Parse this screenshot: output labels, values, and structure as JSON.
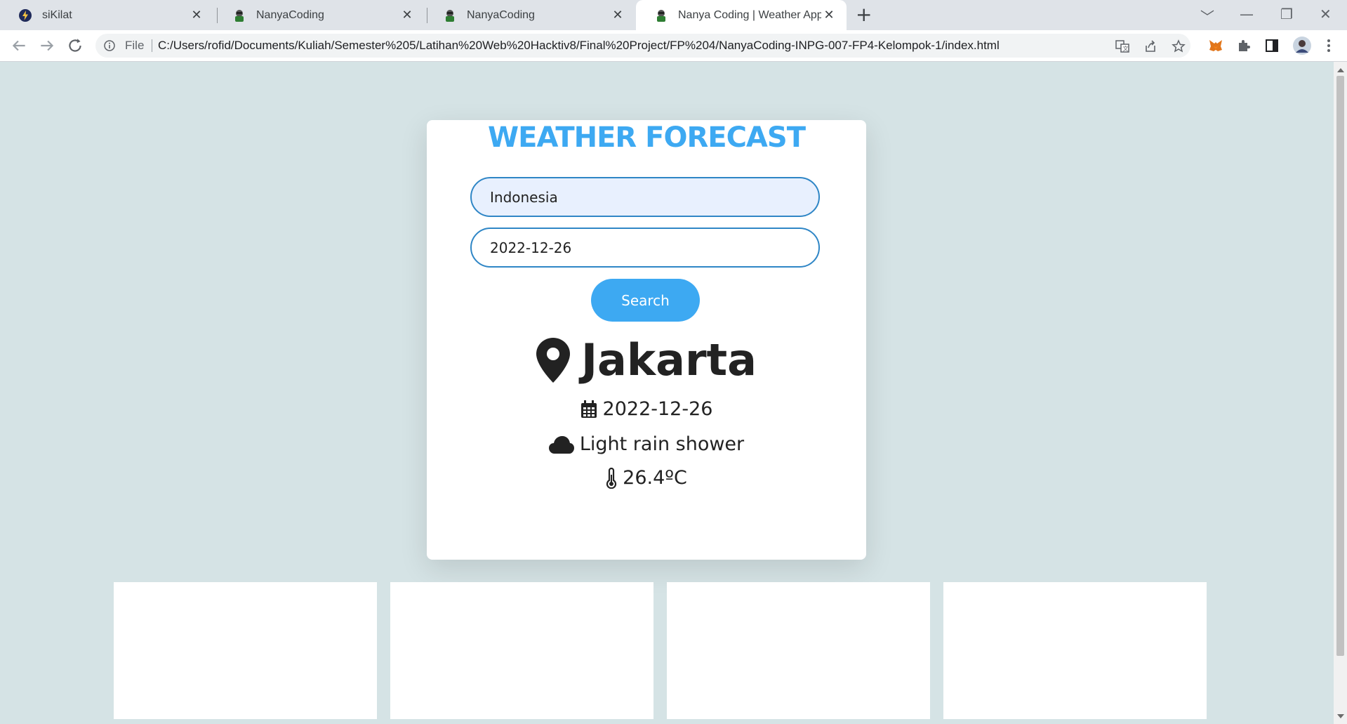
{
  "browser": {
    "tabs": [
      {
        "title": "siKilat"
      },
      {
        "title": "NanyaCoding"
      },
      {
        "title": "NanyaCoding"
      },
      {
        "title": "Nanya Coding | Weather App"
      }
    ],
    "omnibox": {
      "scheme_label": "File",
      "url": "C:/Users/rofid/Documents/Kuliah/Semester%205/Latihan%20Web%20Hacktiv8/Final%20Project/FP%204/NanyaCoding-INPG-007-FP4-Kelompok-1/index.html"
    }
  },
  "page": {
    "title": "WEATHER FORECAST",
    "country_input": {
      "value": "Indonesia"
    },
    "date_input": {
      "value": "2022-12-26"
    },
    "search_label": "Search",
    "result": {
      "city": "Jakarta",
      "date": "2022-12-26",
      "condition": "Light rain shower",
      "temperature": "26.4ºC"
    },
    "forecast_cards": [
      {},
      {},
      {},
      {}
    ]
  },
  "colors": {
    "accent": "#3da9f2",
    "page_bg": "#d5e3e5",
    "input_border": "#2f86c6"
  }
}
